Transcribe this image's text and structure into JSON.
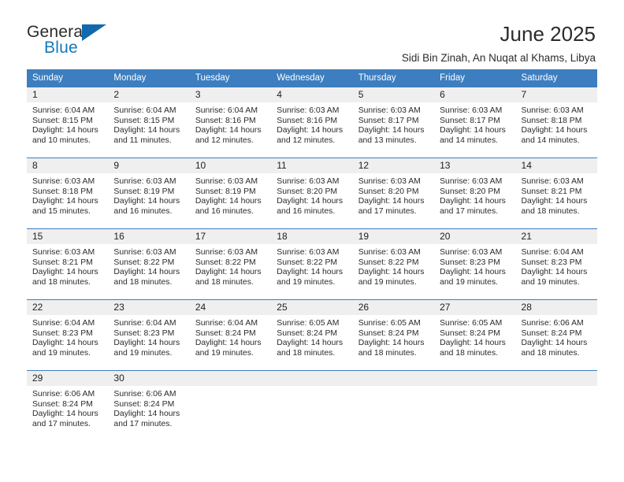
{
  "brand": {
    "name_part1": "General",
    "name_part2": "Blue",
    "triangle_color": "#1169ae",
    "blue_text_color": "#1278be"
  },
  "header": {
    "title": "June 2025",
    "subtitle": "Sidi Bin Zinah, An Nuqat al Khams, Libya"
  },
  "theme": {
    "header_bg": "#3c7ebf",
    "header_text": "#ffffff",
    "daynum_bg": "#efefef",
    "row_border": "#3c7ebf"
  },
  "calendar": {
    "weekday_headers": [
      "Sunday",
      "Monday",
      "Tuesday",
      "Wednesday",
      "Thursday",
      "Friday",
      "Saturday"
    ],
    "weeks": [
      [
        {
          "day": "1",
          "sunrise": "Sunrise: 6:04 AM",
          "sunset": "Sunset: 8:15 PM",
          "daylight_1": "Daylight: 14 hours",
          "daylight_2": "and 10 minutes."
        },
        {
          "day": "2",
          "sunrise": "Sunrise: 6:04 AM",
          "sunset": "Sunset: 8:15 PM",
          "daylight_1": "Daylight: 14 hours",
          "daylight_2": "and 11 minutes."
        },
        {
          "day": "3",
          "sunrise": "Sunrise: 6:04 AM",
          "sunset": "Sunset: 8:16 PM",
          "daylight_1": "Daylight: 14 hours",
          "daylight_2": "and 12 minutes."
        },
        {
          "day": "4",
          "sunrise": "Sunrise: 6:03 AM",
          "sunset": "Sunset: 8:16 PM",
          "daylight_1": "Daylight: 14 hours",
          "daylight_2": "and 12 minutes."
        },
        {
          "day": "5",
          "sunrise": "Sunrise: 6:03 AM",
          "sunset": "Sunset: 8:17 PM",
          "daylight_1": "Daylight: 14 hours",
          "daylight_2": "and 13 minutes."
        },
        {
          "day": "6",
          "sunrise": "Sunrise: 6:03 AM",
          "sunset": "Sunset: 8:17 PM",
          "daylight_1": "Daylight: 14 hours",
          "daylight_2": "and 14 minutes."
        },
        {
          "day": "7",
          "sunrise": "Sunrise: 6:03 AM",
          "sunset": "Sunset: 8:18 PM",
          "daylight_1": "Daylight: 14 hours",
          "daylight_2": "and 14 minutes."
        }
      ],
      [
        {
          "day": "8",
          "sunrise": "Sunrise: 6:03 AM",
          "sunset": "Sunset: 8:18 PM",
          "daylight_1": "Daylight: 14 hours",
          "daylight_2": "and 15 minutes."
        },
        {
          "day": "9",
          "sunrise": "Sunrise: 6:03 AM",
          "sunset": "Sunset: 8:19 PM",
          "daylight_1": "Daylight: 14 hours",
          "daylight_2": "and 16 minutes."
        },
        {
          "day": "10",
          "sunrise": "Sunrise: 6:03 AM",
          "sunset": "Sunset: 8:19 PM",
          "daylight_1": "Daylight: 14 hours",
          "daylight_2": "and 16 minutes."
        },
        {
          "day": "11",
          "sunrise": "Sunrise: 6:03 AM",
          "sunset": "Sunset: 8:20 PM",
          "daylight_1": "Daylight: 14 hours",
          "daylight_2": "and 16 minutes."
        },
        {
          "day": "12",
          "sunrise": "Sunrise: 6:03 AM",
          "sunset": "Sunset: 8:20 PM",
          "daylight_1": "Daylight: 14 hours",
          "daylight_2": "and 17 minutes."
        },
        {
          "day": "13",
          "sunrise": "Sunrise: 6:03 AM",
          "sunset": "Sunset: 8:20 PM",
          "daylight_1": "Daylight: 14 hours",
          "daylight_2": "and 17 minutes."
        },
        {
          "day": "14",
          "sunrise": "Sunrise: 6:03 AM",
          "sunset": "Sunset: 8:21 PM",
          "daylight_1": "Daylight: 14 hours",
          "daylight_2": "and 18 minutes."
        }
      ],
      [
        {
          "day": "15",
          "sunrise": "Sunrise: 6:03 AM",
          "sunset": "Sunset: 8:21 PM",
          "daylight_1": "Daylight: 14 hours",
          "daylight_2": "and 18 minutes."
        },
        {
          "day": "16",
          "sunrise": "Sunrise: 6:03 AM",
          "sunset": "Sunset: 8:22 PM",
          "daylight_1": "Daylight: 14 hours",
          "daylight_2": "and 18 minutes."
        },
        {
          "day": "17",
          "sunrise": "Sunrise: 6:03 AM",
          "sunset": "Sunset: 8:22 PM",
          "daylight_1": "Daylight: 14 hours",
          "daylight_2": "and 18 minutes."
        },
        {
          "day": "18",
          "sunrise": "Sunrise: 6:03 AM",
          "sunset": "Sunset: 8:22 PM",
          "daylight_1": "Daylight: 14 hours",
          "daylight_2": "and 19 minutes."
        },
        {
          "day": "19",
          "sunrise": "Sunrise: 6:03 AM",
          "sunset": "Sunset: 8:22 PM",
          "daylight_1": "Daylight: 14 hours",
          "daylight_2": "and 19 minutes."
        },
        {
          "day": "20",
          "sunrise": "Sunrise: 6:03 AM",
          "sunset": "Sunset: 8:23 PM",
          "daylight_1": "Daylight: 14 hours",
          "daylight_2": "and 19 minutes."
        },
        {
          "day": "21",
          "sunrise": "Sunrise: 6:04 AM",
          "sunset": "Sunset: 8:23 PM",
          "daylight_1": "Daylight: 14 hours",
          "daylight_2": "and 19 minutes."
        }
      ],
      [
        {
          "day": "22",
          "sunrise": "Sunrise: 6:04 AM",
          "sunset": "Sunset: 8:23 PM",
          "daylight_1": "Daylight: 14 hours",
          "daylight_2": "and 19 minutes."
        },
        {
          "day": "23",
          "sunrise": "Sunrise: 6:04 AM",
          "sunset": "Sunset: 8:23 PM",
          "daylight_1": "Daylight: 14 hours",
          "daylight_2": "and 19 minutes."
        },
        {
          "day": "24",
          "sunrise": "Sunrise: 6:04 AM",
          "sunset": "Sunset: 8:24 PM",
          "daylight_1": "Daylight: 14 hours",
          "daylight_2": "and 19 minutes."
        },
        {
          "day": "25",
          "sunrise": "Sunrise: 6:05 AM",
          "sunset": "Sunset: 8:24 PM",
          "daylight_1": "Daylight: 14 hours",
          "daylight_2": "and 18 minutes."
        },
        {
          "day": "26",
          "sunrise": "Sunrise: 6:05 AM",
          "sunset": "Sunset: 8:24 PM",
          "daylight_1": "Daylight: 14 hours",
          "daylight_2": "and 18 minutes."
        },
        {
          "day": "27",
          "sunrise": "Sunrise: 6:05 AM",
          "sunset": "Sunset: 8:24 PM",
          "daylight_1": "Daylight: 14 hours",
          "daylight_2": "and 18 minutes."
        },
        {
          "day": "28",
          "sunrise": "Sunrise: 6:06 AM",
          "sunset": "Sunset: 8:24 PM",
          "daylight_1": "Daylight: 14 hours",
          "daylight_2": "and 18 minutes."
        }
      ],
      [
        {
          "day": "29",
          "sunrise": "Sunrise: 6:06 AM",
          "sunset": "Sunset: 8:24 PM",
          "daylight_1": "Daylight: 14 hours",
          "daylight_2": "and 17 minutes."
        },
        {
          "day": "30",
          "sunrise": "Sunrise: 6:06 AM",
          "sunset": "Sunset: 8:24 PM",
          "daylight_1": "Daylight: 14 hours",
          "daylight_2": "and 17 minutes."
        },
        {
          "day": "",
          "sunrise": "",
          "sunset": "",
          "daylight_1": "",
          "daylight_2": ""
        },
        {
          "day": "",
          "sunrise": "",
          "sunset": "",
          "daylight_1": "",
          "daylight_2": ""
        },
        {
          "day": "",
          "sunrise": "",
          "sunset": "",
          "daylight_1": "",
          "daylight_2": ""
        },
        {
          "day": "",
          "sunrise": "",
          "sunset": "",
          "daylight_1": "",
          "daylight_2": ""
        },
        {
          "day": "",
          "sunrise": "",
          "sunset": "",
          "daylight_1": "",
          "daylight_2": ""
        }
      ]
    ]
  }
}
